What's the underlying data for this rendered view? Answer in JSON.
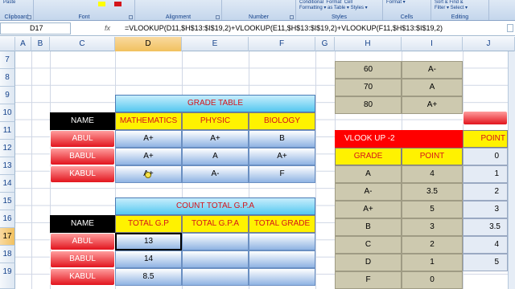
{
  "ribbon": {
    "groups": [
      {
        "label": "Clipboard",
        "item": "Paste"
      },
      {
        "label": "Font",
        "item": ""
      },
      {
        "label": "Alignment",
        "item": ""
      },
      {
        "label": "Number",
        "item": ""
      },
      {
        "label": "Styles",
        "item": "Conditional  Format  Cell\nFormatting ▾ as Table ▾ Styles ▾"
      },
      {
        "label": "Cells",
        "item": "Format ▾"
      },
      {
        "label": "Editing",
        "item": "Sort & Find &\nFilter ▾ Select ▾"
      }
    ]
  },
  "formula_bar": {
    "name_box": "D17",
    "fx": "fx",
    "formula": "=VLOOKUP(D11,$H$13:$I$19,2)+VLOOKUP(E11,$H$13:$I$19,2)+VLOOKUP(F11,$H$13:$I$19,2)"
  },
  "columns": [
    "A",
    "B",
    "C",
    "D",
    "E",
    "F",
    "G",
    "H",
    "I",
    "J"
  ],
  "rows": [
    "7",
    "8",
    "9",
    "10",
    "11",
    "12",
    "13",
    "14",
    "15",
    "16",
    "17",
    "18",
    "19"
  ],
  "selected": {
    "column": "D",
    "row": "17"
  },
  "grade_table": {
    "title": "GRADE TABLE",
    "name_header": "NAME",
    "subjects": [
      "MATHEMATICS",
      "PHYSIC",
      "BIOLOGY"
    ],
    "rows": [
      {
        "name": "ABUL",
        "grades": [
          "A+",
          "A+",
          "B"
        ]
      },
      {
        "name": "BABUL",
        "grades": [
          "A+",
          "A",
          "A+"
        ]
      },
      {
        "name": "KABUL",
        "grades": [
          "A+",
          "A-",
          "F"
        ]
      }
    ]
  },
  "gpa_table": {
    "title": "COUNT TOTAL G.P.A",
    "name_header": "NAME",
    "headers": [
      "TOTAL G.P",
      "TOTAL G.P.A",
      "TOTAL GRADE"
    ],
    "rows": [
      {
        "name": "ABUL",
        "values": [
          "13",
          "",
          ""
        ]
      },
      {
        "name": "BABUL",
        "values": [
          "14",
          "",
          ""
        ]
      },
      {
        "name": "KABUL",
        "values": [
          "8.5",
          "",
          ""
        ]
      }
    ]
  },
  "upper_h_i": [
    {
      "h": "60",
      "i": "A-"
    },
    {
      "h": "70",
      "i": "A"
    },
    {
      "h": "80",
      "i": "A+"
    }
  ],
  "lookup": {
    "title": "VLOOK UP -2",
    "headers": [
      "GRADE",
      "POINT"
    ],
    "rows": [
      {
        "grade": "A",
        "point": "4"
      },
      {
        "grade": "A-",
        "point": "3.5"
      },
      {
        "grade": "A+",
        "point": "5"
      },
      {
        "grade": "B",
        "point": "3"
      },
      {
        "grade": "C",
        "point": "2"
      },
      {
        "grade": "D",
        "point": "1"
      },
      {
        "grade": "F",
        "point": "0"
      }
    ]
  },
  "col_j": {
    "header": "POINT",
    "values": [
      "0",
      "1",
      "2",
      "3",
      "3.5",
      "4",
      "5"
    ]
  },
  "colors": {
    "header_yellow": "#fff200",
    "title_cyan": "#55c7f0",
    "name_red": "#e2141d",
    "lookup_red": "#ff0000",
    "lookup_tan": "#cdc9af"
  }
}
